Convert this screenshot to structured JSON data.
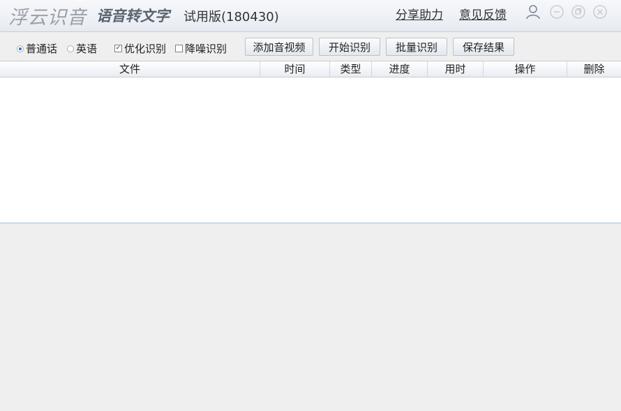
{
  "header": {
    "brand": "浮云识音",
    "subtitle": "语音转文字",
    "version": "试用版(180430)",
    "share_link": "分享助力",
    "feedback_link": "意见反馈"
  },
  "toolbar": {
    "lang_mandarin": "普通话",
    "lang_english": "英语",
    "selected_language": "普通话",
    "optimize_label": "优化识别",
    "optimize_checked": true,
    "denoise_label": "降噪识别",
    "denoise_checked": false,
    "add_media_button": "添加音视频",
    "start_button": "开始识别",
    "batch_button": "批量识别",
    "save_button": "保存结果"
  },
  "table": {
    "columns": [
      "文件",
      "时间",
      "类型",
      "进度",
      "用时",
      "操作",
      "删除"
    ],
    "rows": []
  },
  "colors": {
    "accent": "#2f6fd0",
    "title_bar": "#e7ebf1",
    "background": "#efefef"
  }
}
